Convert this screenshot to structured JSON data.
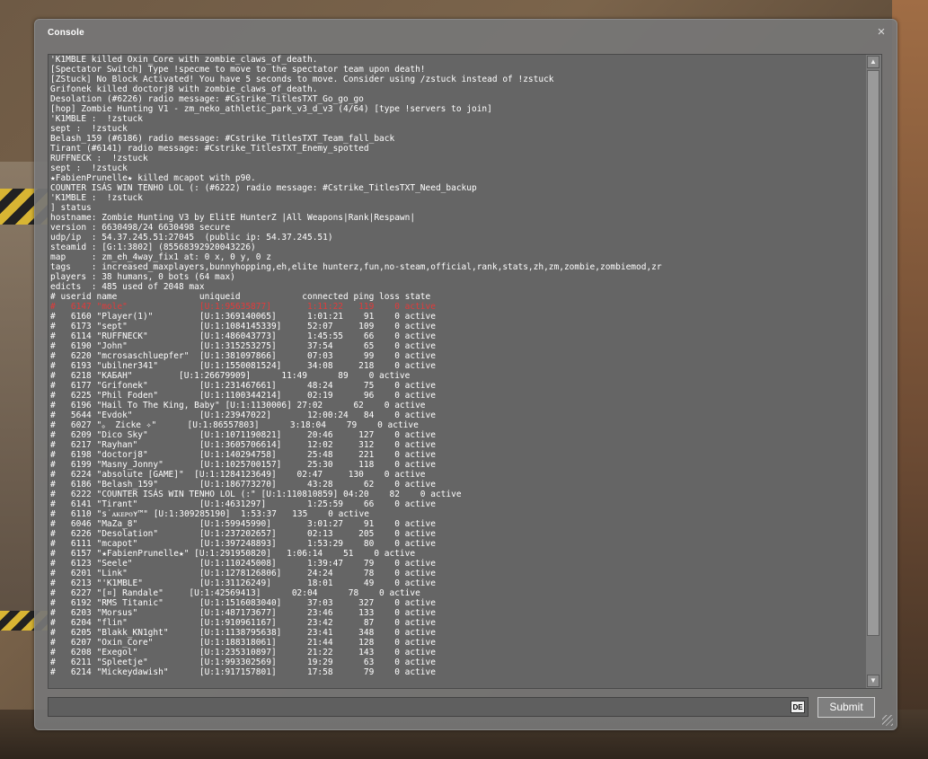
{
  "window": {
    "title": "Console",
    "close_glyph": "×"
  },
  "log_lines": [
    {
      "text": "'K1MBLE killed Oxin_Core with zombie_claws_of_death.",
      "style": "normal"
    },
    {
      "text": "[Spectator Switch] Type !specme to move to the spectator team upon death!",
      "style": "normal"
    },
    {
      "text": "[ZStuck] No Block Activated! You have 5 seconds to move. Consider using /zstuck instead of !zstuck",
      "style": "normal"
    },
    {
      "text": "Grifonek killed doctorj8 with zombie_claws_of_death.",
      "style": "normal"
    },
    {
      "text": "Desolation (#6226) radio message: #Cstrike_TitlesTXT_Go_go_go",
      "style": "normal"
    },
    {
      "text": "[hop] Zombie Hunting V1 - zm_neko_athletic_park_v3_d_v3 (4/64) [type !servers to join]",
      "style": "normal"
    },
    {
      "text": "'K1MBLE :  !zstuck",
      "style": "normal"
    },
    {
      "text": "sept :  !zstuck",
      "style": "normal"
    },
    {
      "text": "Belash_159 (#6186) radio message: #Cstrike_TitlesTXT_Team_fall_back",
      "style": "normal"
    },
    {
      "text": "Tirant (#6141) radio message: #Cstrike_TitlesTXT_Enemy_spotted",
      "style": "normal"
    },
    {
      "text": "RUFFNECK :  !zstuck",
      "style": "normal"
    },
    {
      "text": "sept :  !zstuck",
      "style": "normal"
    },
    {
      "text": "★FabienPrunelle★ killed mcapot with p90.",
      "style": "normal"
    },
    {
      "text": "COUNTER ISÁS WIN TENHO LOL (: (#6222) radio message: #Cstrike_TitlesTXT_Need_backup",
      "style": "normal"
    },
    {
      "text": "'K1MBLE :  !zstuck",
      "style": "normal"
    },
    {
      "text": "] status",
      "style": "normal"
    },
    {
      "text": "hostname: Zombie Hunting V3 by ElitE HunterZ |All Weapons|Rank|Respawn|",
      "style": "normal"
    },
    {
      "text": "version : 6630498/24 6630498 secure",
      "style": "normal"
    },
    {
      "text": "udp/ip  : 54.37.245.51:27045  (public ip: 54.37.245.51)",
      "style": "normal"
    },
    {
      "text": "steamid : [G:1:3802] (85568392920043226)",
      "style": "normal"
    },
    {
      "text": "map     : zm_eh_4way_fix1 at: 0 x, 0 y, 0 z",
      "style": "normal"
    },
    {
      "text": "tags    : increased_maxplayers,bunnyhopping,eh,elite hunterz,fun,no-steam,official,rank,stats,zh,zm,zombie,zombiemod,zr",
      "style": "normal"
    },
    {
      "text": "players : 38 humans, 0 bots (64 max)",
      "style": "normal"
    },
    {
      "text": "edicts  : 485 used of 2048 max",
      "style": "normal"
    },
    {
      "text": "# userid name                uniqueid            connected ping loss state",
      "style": "normal"
    },
    {
      "text": "#   6147 \"mole\"              [U:1:95635877]       1:11:22   119    0 active",
      "style": "hl"
    },
    {
      "text": "#   6160 \"Player(1)\"         [U:1:369140065]      1:01:21    91    0 active",
      "style": "normal"
    },
    {
      "text": "#   6173 \"sept\"              [U:1:1084145339]     52:07     109    0 active",
      "style": "normal"
    },
    {
      "text": "#   6114 \"RUFFNECK\"          [U:1:486043773]      1:45:55    66    0 active",
      "style": "normal"
    },
    {
      "text": "#   6190 \"John\"              [U:1:315253275]      37:54      65    0 active",
      "style": "normal"
    },
    {
      "text": "#   6220 \"mcrosaschluepfer\"  [U:1:381097866]      07:03      99    0 active",
      "style": "normal"
    },
    {
      "text": "#   6193 \"ubilner341\"        [U:1:1550081524]     34:08     218    0 active",
      "style": "normal"
    },
    {
      "text": "#   6218 \"КАБАН\"         [U:1:26679909]      11:49      89    0 active",
      "style": "normal"
    },
    {
      "text": "#   6177 \"Grifonek\"          [U:1:231467661]      48:24      75    0 active",
      "style": "normal"
    },
    {
      "text": "#   6225 \"Phil Foden\"        [U:1:1100344214]     02:19      96    0 active",
      "style": "normal"
    },
    {
      "text": "#   6196 \"Hail To The King, Baby\" [U:1:1130006] 27:02      62    0 active",
      "style": "normal"
    },
    {
      "text": "#   5644 \"Evdok\"             [U:1:23947022]       12:00:24   84    0 active",
      "style": "normal"
    },
    {
      "text": "#   6027 \"。 Zicke ✧\"      [U:1:86557803]      3:18:04    79    0 active",
      "style": "normal"
    },
    {
      "text": "#   6209 \"Dico Sky\"          [U:1:1071190821]     20:46     127    0 active",
      "style": "normal"
    },
    {
      "text": "#   6217 \"Rayhan\"            [U:1:3605706614]     12:02     312    0 active",
      "style": "normal"
    },
    {
      "text": "#   6198 \"doctorj8\"          [U:1:140294758]      25:48     221    0 active",
      "style": "normal"
    },
    {
      "text": "#   6199 \"Masny_Jonny\"       [U:1:1025700157]     25:30     118    0 active",
      "style": "normal"
    },
    {
      "text": "#   6224 \"absolute [GAME]\"  [U:1:1284123649]    02:47     130    0 active",
      "style": "normal"
    },
    {
      "text": "#   6186 \"Belash_159\"        [U:1:186773270]      43:28      62    0 active",
      "style": "normal"
    },
    {
      "text": "#   6222 \"COUNTER ISÁS WIN TENHO LOL (:\" [U:1:110810859] 04:20    82    0 active",
      "style": "normal"
    },
    {
      "text": "#   6141 \"Tirant\"            [U:1:4631297]        1:25:59    66    0 active",
      "style": "normal"
    },
    {
      "text": "#   6110 \"s˙ᴀᴋᴇᴘᴏʏ™\" [U:1:309285190]  1:53:37   135    0 active",
      "style": "normal"
    },
    {
      "text": "#   6046 \"MaZa_8\"            [U:1:59945990]       3:01:27    91    0 active",
      "style": "normal"
    },
    {
      "text": "#   6226 \"Desolation\"        [U:1:237202657]      02:13     205    0 active",
      "style": "normal"
    },
    {
      "text": "#   6111 \"mcapot\"            [U:1:397248893]      1:53:29    80    0 active",
      "style": "normal"
    },
    {
      "text": "#   6157 \"★FabienPrunelle★\" [U:1:291950820]   1:06:14    51    0 active",
      "style": "normal"
    },
    {
      "text": "#   6123 \"Seele\"             [U:1:110245008]      1:39:47    79    0 active",
      "style": "normal"
    },
    {
      "text": "#   6201 \"Link\"              [U:1:1278126806]     24:24      78    0 active",
      "style": "normal"
    },
    {
      "text": "#   6213 \"'K1MBLE\"           [U:1:31126249]       18:01      49    0 active",
      "style": "normal"
    },
    {
      "text": "#   6227 \"[¤] Randale\"     [U:1:42569413]      02:04      78    0 active",
      "style": "normal"
    },
    {
      "text": "#   6192 \"RMS Titanic\"       [U:1:1516083040]     37:03     327    0 active",
      "style": "normal"
    },
    {
      "text": "#   6203 \"Morsus\"            [U:1:487173677]      23:46     133    0 active",
      "style": "normal"
    },
    {
      "text": "#   6204 \"flin\"              [U:1:910961167]      23:42      87    0 active",
      "style": "normal"
    },
    {
      "text": "#   6205 \"Blakk_KN1ght\"      [U:1:1138795638]     23:41     348    0 active",
      "style": "normal"
    },
    {
      "text": "#   6207 \"Oxin_Core\"         [U:1:188318061]      21:44     128    0 active",
      "style": "normal"
    },
    {
      "text": "#   6208 \"Exegol\"            [U:1:235310897]      21:22     143    0 active",
      "style": "normal"
    },
    {
      "text": "#   6211 \"Spleetje\"          [U:1:993302569]      19:29      63    0 active",
      "style": "normal"
    },
    {
      "text": "#   6214 \"Mickeydawish\"      [U:1:917157801]      17:58      79    0 active",
      "style": "normal"
    }
  ],
  "input": {
    "value": "",
    "placeholder": "",
    "language_indicator": "DE"
  },
  "submit_label": "Submit",
  "scrollbar": {
    "up_glyph": "▲",
    "down_glyph": "▼"
  },
  "colors": {
    "window_bg": "#767676",
    "log_bg": "#656565",
    "text": "#ffffff",
    "highlight": "#e23b3b"
  },
  "icons": {
    "close": "close-icon",
    "scroll_up": "arrow-up-icon",
    "scroll_down": "arrow-down-icon",
    "resize": "resize-grip-icon"
  }
}
